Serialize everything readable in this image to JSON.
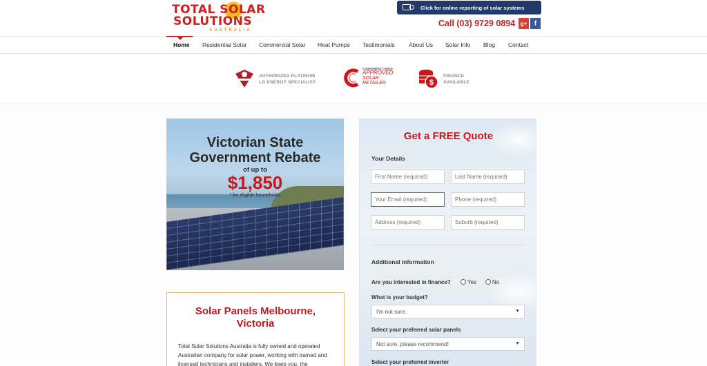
{
  "header": {
    "logo": {
      "line1": "TOTAL SOLAR",
      "line2": "SOLUTIONS",
      "line3": "AUSTRALIA"
    },
    "report_button": "Click for online reporting of solar systems",
    "phone": "Call (03) 9729 0894",
    "social": {
      "gplus": "g+",
      "facebook": "f"
    }
  },
  "nav": {
    "items": [
      "Home",
      "Residential Solar",
      "Commercial Solar",
      "Heat Pumps",
      "Testimonials",
      "About Us",
      "Solar Info",
      "Blog",
      "Contact"
    ],
    "active": "Home"
  },
  "badges": [
    {
      "icon": "lg-badge-icon",
      "line1": "AUTHORIZED PLATINUM",
      "line2": "LG ENERGY SPECIALIST"
    },
    {
      "icon": "cec-approved-icon",
      "line1": "CLEAN ENERGY COUNCIL",
      "line2": "APPROVED",
      "line3": "SOLAR",
      "line4": "RETAILER"
    },
    {
      "icon": "finance-coins-icon",
      "line1": "FINANCE",
      "line2": "AVAILABLE"
    }
  ],
  "hero": {
    "title_line1": "Victorian State",
    "title_line2": "Government Rebate",
    "upto": "of up to",
    "amount": "$1,850",
    "note": "* for eligible households"
  },
  "intro": {
    "title_line1": "Solar Panels Melbourne,",
    "title_line2": "Victoria",
    "text": "Total Solar Solutions Australia is fully owned and operated Australian company for solar power, working with trained and licensed technicians and installers. We keep you, the"
  },
  "quote": {
    "title": "Get a FREE Quote",
    "your_details": "Your Details",
    "fields": {
      "first_name": "First Name (required)",
      "last_name": "Last Name (required)",
      "email": "Your Email (required)",
      "phone": "Phone (required)",
      "address": "Address (required)",
      "suburb": "Suburb (required)"
    },
    "additional_info": "Additional information",
    "finance_question": "Are you interested in finance?",
    "finance_yes": "Yes",
    "finance_no": "No",
    "budget_label": "What is your budget?",
    "budget_value": "I'm not sure.",
    "panels_label": "Select your preferred solar panels",
    "panels_value": "Not sure, please recommend!",
    "inverter_label": "Select your preferred inverter"
  },
  "colors": {
    "brand_red": "#c8171c",
    "nav_text": "#333333",
    "report_button_bg": "#223a6a"
  }
}
